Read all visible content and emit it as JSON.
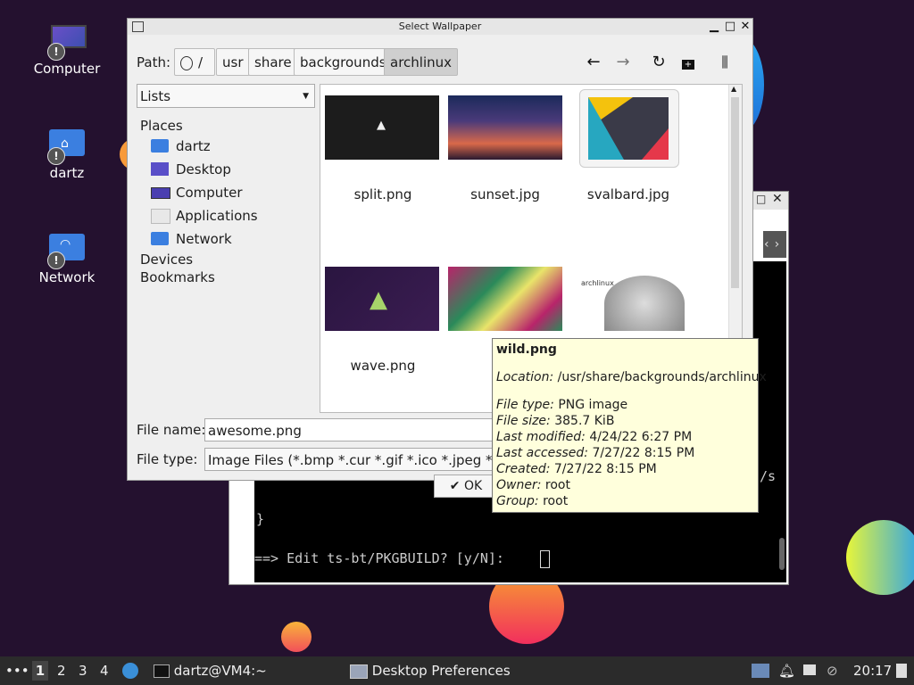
{
  "desktop": {
    "icons": [
      {
        "label": "Computer",
        "icon": "monitor-icon"
      },
      {
        "label": "dartz",
        "icon": "home-folder-icon"
      },
      {
        "label": "Network",
        "icon": "network-folder-icon"
      }
    ]
  },
  "terminal": {
    "prompt_line": "==> Edit ts-bt/PKGBUILD? [y/N]:",
    "fragment_brace": "}",
    "fragment_s": "/s"
  },
  "dialog": {
    "title": "Select Wallpaper",
    "path_label": "Path:",
    "crumbs": [
      "/",
      "usr",
      "share",
      "backgrounds",
      "archlinux"
    ],
    "view_mode": "Lists",
    "places_heading": "Places",
    "places": [
      {
        "label": "dartz",
        "icon": "home-folder-icon"
      },
      {
        "label": "Desktop",
        "icon": "desktop-icon"
      },
      {
        "label": "Computer",
        "icon": "monitor-icon"
      },
      {
        "label": "Applications",
        "icon": "applications-icon"
      },
      {
        "label": "Network",
        "icon": "network-folder-icon"
      }
    ],
    "devices_heading": "Devices",
    "bookmarks_heading": "Bookmarks",
    "files": [
      "split.png",
      "sunset.jpg",
      "svalbard.jpg",
      "wave.png",
      "wi",
      "archlinux"
    ],
    "file_name_label": "File name:",
    "file_name_value": "awesome.png",
    "file_type_label": "File type:",
    "file_type_value": "Image Files (*.bmp *.cur *.gif *.ico *.jpeg *.jpg *.",
    "ok_label": "OK"
  },
  "tooltip": {
    "name": "wild.png",
    "location_label": "Location:",
    "location": "/usr/share/backgrounds/archlinux",
    "file_type_label": "File type:",
    "file_type": "PNG image",
    "file_size_label": "File size:",
    "file_size": "385.7 KiB",
    "modified_label": "Last modified:",
    "modified": "4/24/22 6:27 PM",
    "accessed_label": "Last accessed:",
    "accessed": "7/27/22 8:15 PM",
    "created_label": "Created:",
    "created": "7/27/22 8:15 PM",
    "owner_label": "Owner:",
    "owner": "root",
    "group_label": "Group:",
    "group": "root"
  },
  "taskbar": {
    "menu": "•••",
    "workspaces": [
      "1",
      "2",
      "3",
      "4"
    ],
    "terminal_task": "dartz@VM4:~",
    "prefs_task": "Desktop Preferences",
    "clock": "20:17"
  },
  "colors": {
    "accent_folder": "#3b7fe0",
    "desktop_bg": "#24112f",
    "tooltip_bg": "#ffffdc"
  }
}
